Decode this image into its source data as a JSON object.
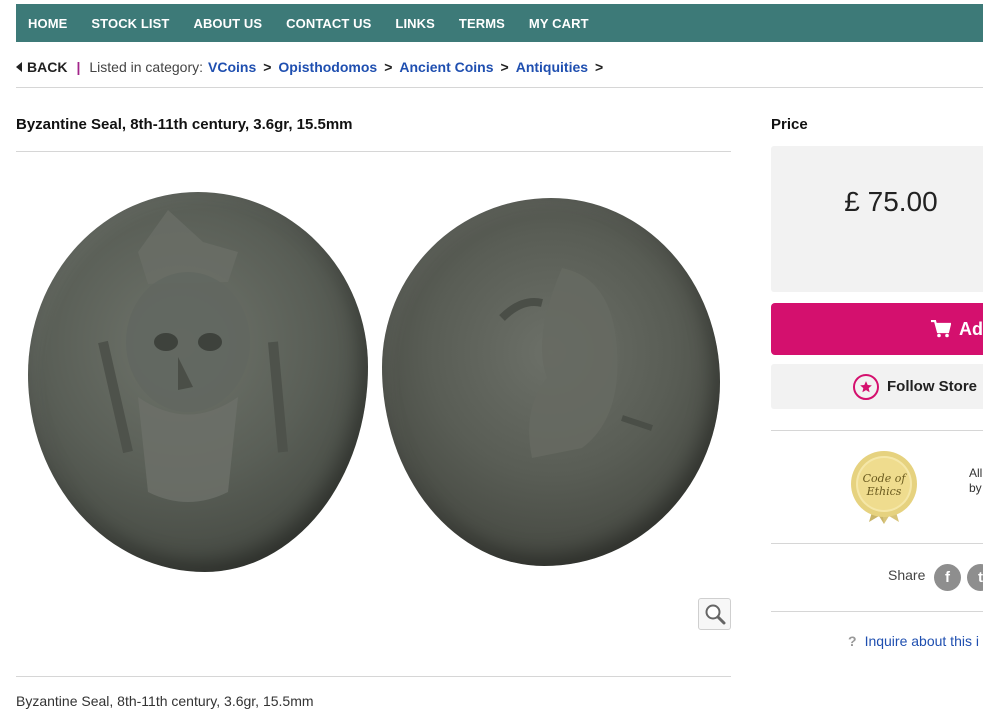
{
  "nav": {
    "items": [
      "HOME",
      "STOCK LIST",
      "ABOUT US",
      "CONTACT US",
      "LINKS",
      "TERMS",
      "MY CART"
    ]
  },
  "breadcrumb": {
    "back": "BACK",
    "separator": "|",
    "listed_label": "Listed in category:",
    "links": [
      "VCoins",
      "Opisthodomos",
      "Ancient Coins",
      "Antiquities"
    ],
    "arrow": ">"
  },
  "product": {
    "title": "Byzantine Seal, 8th-11th century, 3.6gr, 15.5mm",
    "caption": "Byzantine Seal, 8th-11th century, 3.6gr, 15.5mm"
  },
  "sidebar": {
    "price_label": "Price",
    "price": "£ 75.00",
    "add_label": "Ad",
    "follow_label": "Follow Store",
    "ethics_seal": "Code of Ethics",
    "ethics_text_1": "All",
    "ethics_text_2": "by",
    "share_label": "Share",
    "facebook": "f",
    "twitter": "t",
    "inquire_icon": "?",
    "inquire_label": "Inquire about this i"
  },
  "colors": {
    "nav_bg": "#3d7a78",
    "accent": "#d4106e",
    "link": "#1f4fb0"
  }
}
